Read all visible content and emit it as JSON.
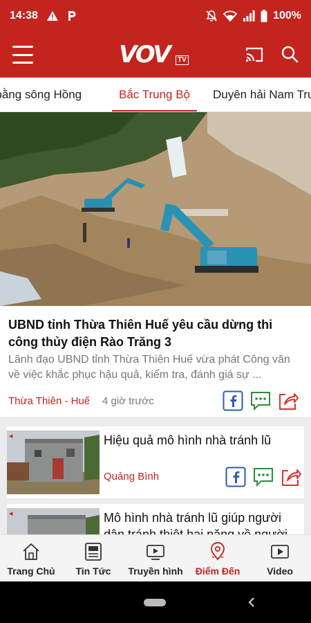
{
  "status_bar": {
    "time": "14:38",
    "battery": "100%",
    "notification_icons": [
      "warning-icon",
      "p-icon"
    ],
    "system_icons": [
      "mute-icon",
      "wifi-icon",
      "signal-icon",
      "battery-icon"
    ]
  },
  "app_bar": {
    "logo_text": "VOV",
    "logo_suffix": "TV",
    "brand_color": "#c3241e"
  },
  "tabs": [
    {
      "label": "Đồng bằng sông Hồng"
    },
    {
      "label": "Bắc Trung Bộ",
      "active": true
    },
    {
      "label": "Duyên hải Nam Trung Bộ"
    }
  ],
  "featured": {
    "title": "UBND tỉnh Thừa Thiên Huế yêu cầu dừng thi công thủy điện Rào Trăng 3",
    "summary": "Lãnh đạo UBND tỉnh Thừa Thiên Huế vừa phát Công văn về việc khắc phục hậu quả, kiểm tra, đánh giá sự ...",
    "region": "Thừa Thiên - Huế",
    "time": "4 giờ trước"
  },
  "articles": [
    {
      "title": "Hiệu quả mô hình nhà tránh lũ",
      "region": "Quảng Bình"
    },
    {
      "title": "Mô hình nhà tránh lũ giúp người dân tránh thiệt hại nặng về người",
      "region": ""
    }
  ],
  "bottom_nav": [
    {
      "label": "Trang Chủ",
      "icon": "home-icon"
    },
    {
      "label": "Tin Tức",
      "icon": "news-icon"
    },
    {
      "label": "Truyền hình",
      "icon": "tv-icon"
    },
    {
      "label": "Điểm Đến",
      "icon": "location-icon",
      "active": true
    },
    {
      "label": "Video",
      "icon": "video-icon"
    }
  ]
}
